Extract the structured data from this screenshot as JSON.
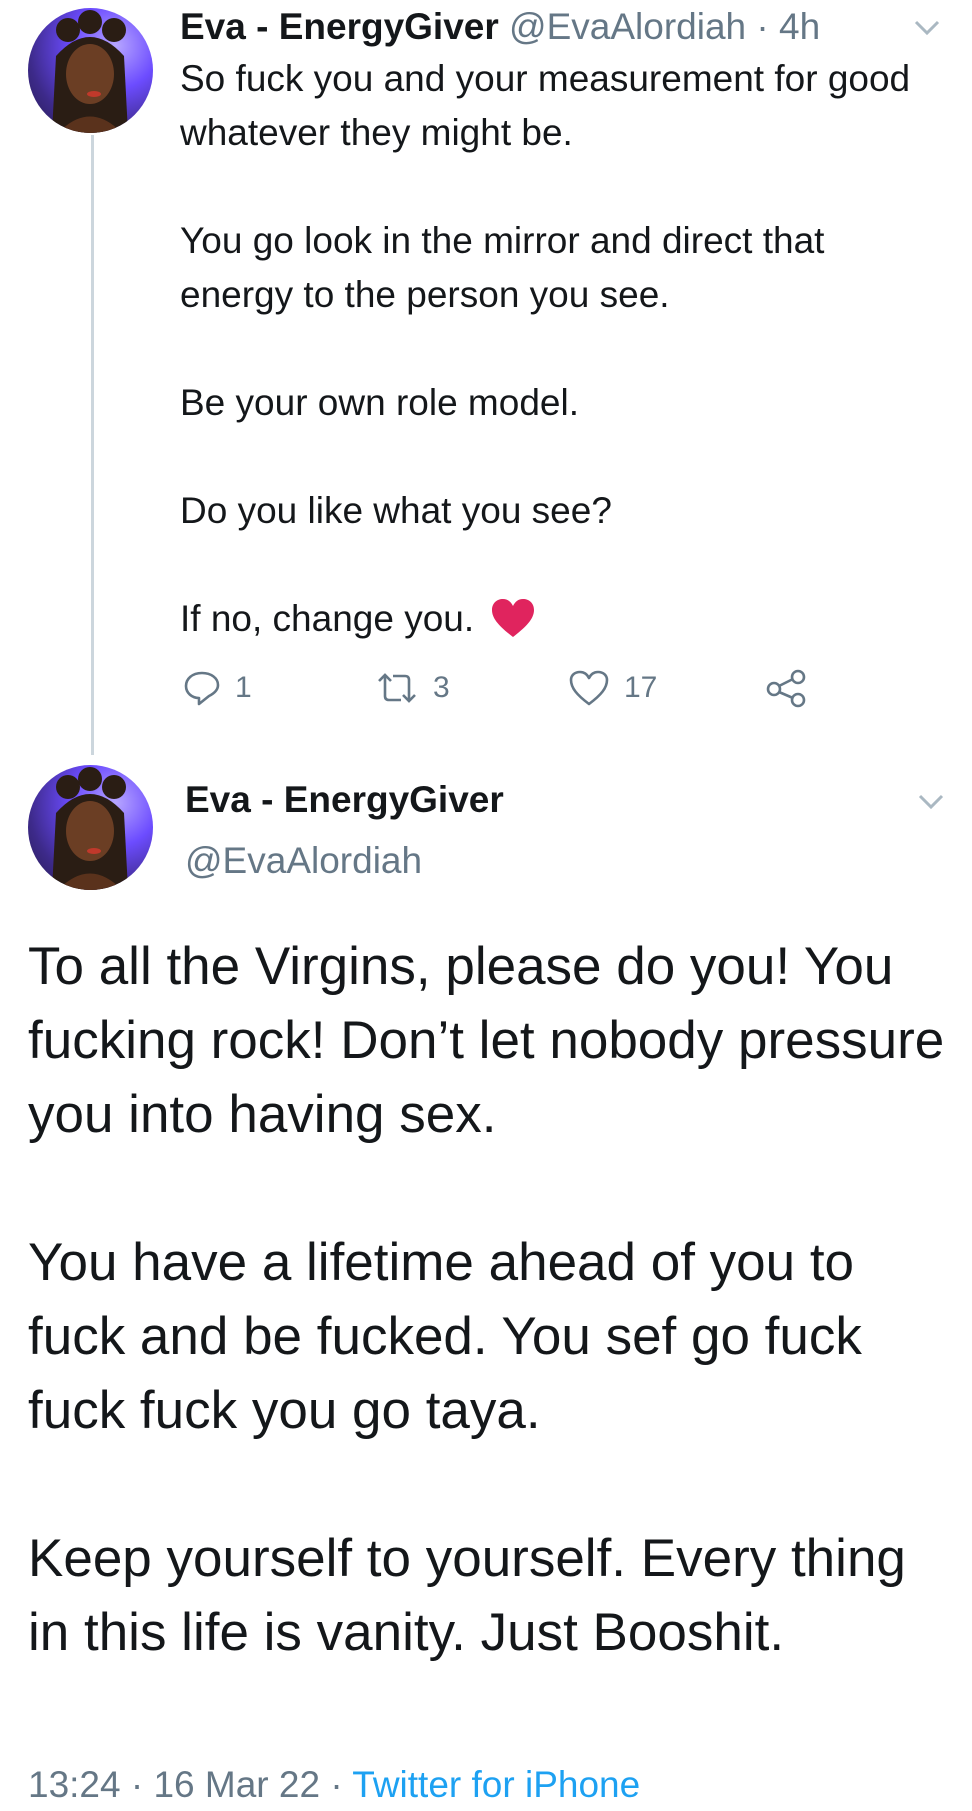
{
  "thread_tweet": {
    "author_name": "Eva - EnergyGiver",
    "handle": "@EvaAlordiah",
    "time": "4h",
    "paragraphs": [
      "So fuck you and your measurement for good whatever they might be.",
      "You go look in the mirror and direct that energy to the person you see.",
      "Be your own role model.",
      "Do you like what you see?",
      "If no, change you."
    ],
    "emoji": "❤️",
    "actions": {
      "replies": "1",
      "retweets": "3",
      "likes": "17"
    }
  },
  "main_tweet": {
    "author_name": "Eva - EnergyGiver",
    "handle": "@EvaAlordiah",
    "paragraphs": [
      "To all the Virgins, please do you! You fucking rock! Don’t let nobody pressure you into having sex.",
      "You have a lifetime ahead of you to fuck and be fucked. You sef go fuck fuck fuck you go taya.",
      "Keep yourself to yourself. Every thing in this life is vanity. Just Booshit."
    ],
    "timestamp": "13:24 · 16 Mar 22 · ",
    "source": "Twitter for iPhone"
  },
  "icons": {
    "reply": "reply-icon",
    "retweet": "retweet-icon",
    "like": "heart-icon",
    "share": "share-icon",
    "menu": "chevron-down-icon"
  },
  "colors": {
    "text": "#14171a",
    "muted": "#657786",
    "link": "#1da1f2",
    "heart": "#e0245e",
    "thread_line": "#ccd6dd"
  }
}
